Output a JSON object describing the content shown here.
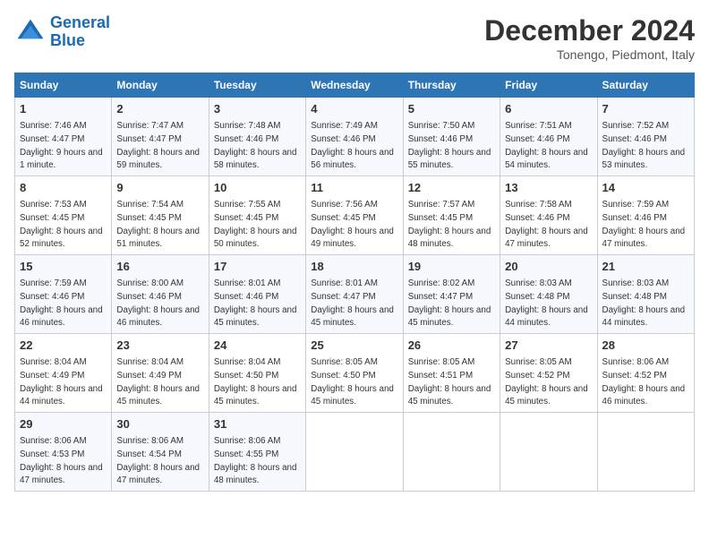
{
  "header": {
    "logo_line1": "General",
    "logo_line2": "Blue",
    "month": "December 2024",
    "location": "Tonengo, Piedmont, Italy"
  },
  "weekdays": [
    "Sunday",
    "Monday",
    "Tuesday",
    "Wednesday",
    "Thursday",
    "Friday",
    "Saturday"
  ],
  "weeks": [
    [
      {
        "day": "1",
        "sunrise": "Sunrise: 7:46 AM",
        "sunset": "Sunset: 4:47 PM",
        "daylight": "Daylight: 9 hours and 1 minute."
      },
      {
        "day": "2",
        "sunrise": "Sunrise: 7:47 AM",
        "sunset": "Sunset: 4:47 PM",
        "daylight": "Daylight: 8 hours and 59 minutes."
      },
      {
        "day": "3",
        "sunrise": "Sunrise: 7:48 AM",
        "sunset": "Sunset: 4:46 PM",
        "daylight": "Daylight: 8 hours and 58 minutes."
      },
      {
        "day": "4",
        "sunrise": "Sunrise: 7:49 AM",
        "sunset": "Sunset: 4:46 PM",
        "daylight": "Daylight: 8 hours and 56 minutes."
      },
      {
        "day": "5",
        "sunrise": "Sunrise: 7:50 AM",
        "sunset": "Sunset: 4:46 PM",
        "daylight": "Daylight: 8 hours and 55 minutes."
      },
      {
        "day": "6",
        "sunrise": "Sunrise: 7:51 AM",
        "sunset": "Sunset: 4:46 PM",
        "daylight": "Daylight: 8 hours and 54 minutes."
      },
      {
        "day": "7",
        "sunrise": "Sunrise: 7:52 AM",
        "sunset": "Sunset: 4:46 PM",
        "daylight": "Daylight: 8 hours and 53 minutes."
      }
    ],
    [
      {
        "day": "8",
        "sunrise": "Sunrise: 7:53 AM",
        "sunset": "Sunset: 4:45 PM",
        "daylight": "Daylight: 8 hours and 52 minutes."
      },
      {
        "day": "9",
        "sunrise": "Sunrise: 7:54 AM",
        "sunset": "Sunset: 4:45 PM",
        "daylight": "Daylight: 8 hours and 51 minutes."
      },
      {
        "day": "10",
        "sunrise": "Sunrise: 7:55 AM",
        "sunset": "Sunset: 4:45 PM",
        "daylight": "Daylight: 8 hours and 50 minutes."
      },
      {
        "day": "11",
        "sunrise": "Sunrise: 7:56 AM",
        "sunset": "Sunset: 4:45 PM",
        "daylight": "Daylight: 8 hours and 49 minutes."
      },
      {
        "day": "12",
        "sunrise": "Sunrise: 7:57 AM",
        "sunset": "Sunset: 4:45 PM",
        "daylight": "Daylight: 8 hours and 48 minutes."
      },
      {
        "day": "13",
        "sunrise": "Sunrise: 7:58 AM",
        "sunset": "Sunset: 4:46 PM",
        "daylight": "Daylight: 8 hours and 47 minutes."
      },
      {
        "day": "14",
        "sunrise": "Sunrise: 7:59 AM",
        "sunset": "Sunset: 4:46 PM",
        "daylight": "Daylight: 8 hours and 47 minutes."
      }
    ],
    [
      {
        "day": "15",
        "sunrise": "Sunrise: 7:59 AM",
        "sunset": "Sunset: 4:46 PM",
        "daylight": "Daylight: 8 hours and 46 minutes."
      },
      {
        "day": "16",
        "sunrise": "Sunrise: 8:00 AM",
        "sunset": "Sunset: 4:46 PM",
        "daylight": "Daylight: 8 hours and 46 minutes."
      },
      {
        "day": "17",
        "sunrise": "Sunrise: 8:01 AM",
        "sunset": "Sunset: 4:46 PM",
        "daylight": "Daylight: 8 hours and 45 minutes."
      },
      {
        "day": "18",
        "sunrise": "Sunrise: 8:01 AM",
        "sunset": "Sunset: 4:47 PM",
        "daylight": "Daylight: 8 hours and 45 minutes."
      },
      {
        "day": "19",
        "sunrise": "Sunrise: 8:02 AM",
        "sunset": "Sunset: 4:47 PM",
        "daylight": "Daylight: 8 hours and 45 minutes."
      },
      {
        "day": "20",
        "sunrise": "Sunrise: 8:03 AM",
        "sunset": "Sunset: 4:48 PM",
        "daylight": "Daylight: 8 hours and 44 minutes."
      },
      {
        "day": "21",
        "sunrise": "Sunrise: 8:03 AM",
        "sunset": "Sunset: 4:48 PM",
        "daylight": "Daylight: 8 hours and 44 minutes."
      }
    ],
    [
      {
        "day": "22",
        "sunrise": "Sunrise: 8:04 AM",
        "sunset": "Sunset: 4:49 PM",
        "daylight": "Daylight: 8 hours and 44 minutes."
      },
      {
        "day": "23",
        "sunrise": "Sunrise: 8:04 AM",
        "sunset": "Sunset: 4:49 PM",
        "daylight": "Daylight: 8 hours and 45 minutes."
      },
      {
        "day": "24",
        "sunrise": "Sunrise: 8:04 AM",
        "sunset": "Sunset: 4:50 PM",
        "daylight": "Daylight: 8 hours and 45 minutes."
      },
      {
        "day": "25",
        "sunrise": "Sunrise: 8:05 AM",
        "sunset": "Sunset: 4:50 PM",
        "daylight": "Daylight: 8 hours and 45 minutes."
      },
      {
        "day": "26",
        "sunrise": "Sunrise: 8:05 AM",
        "sunset": "Sunset: 4:51 PM",
        "daylight": "Daylight: 8 hours and 45 minutes."
      },
      {
        "day": "27",
        "sunrise": "Sunrise: 8:05 AM",
        "sunset": "Sunset: 4:52 PM",
        "daylight": "Daylight: 8 hours and 45 minutes."
      },
      {
        "day": "28",
        "sunrise": "Sunrise: 8:06 AM",
        "sunset": "Sunset: 4:52 PM",
        "daylight": "Daylight: 8 hours and 46 minutes."
      }
    ],
    [
      {
        "day": "29",
        "sunrise": "Sunrise: 8:06 AM",
        "sunset": "Sunset: 4:53 PM",
        "daylight": "Daylight: 8 hours and 47 minutes."
      },
      {
        "day": "30",
        "sunrise": "Sunrise: 8:06 AM",
        "sunset": "Sunset: 4:54 PM",
        "daylight": "Daylight: 8 hours and 47 minutes."
      },
      {
        "day": "31",
        "sunrise": "Sunrise: 8:06 AM",
        "sunset": "Sunset: 4:55 PM",
        "daylight": "Daylight: 8 hours and 48 minutes."
      },
      null,
      null,
      null,
      null
    ]
  ]
}
